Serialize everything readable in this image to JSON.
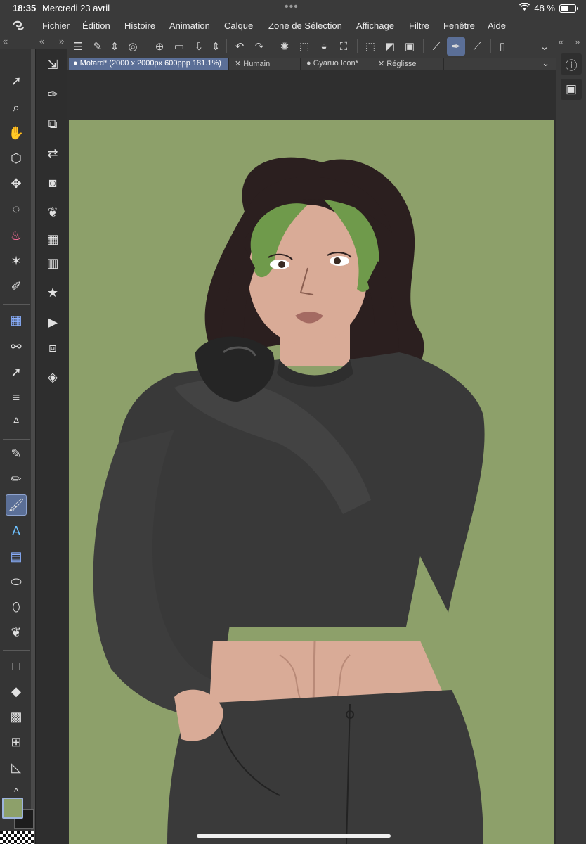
{
  "status": {
    "time": "18:35",
    "date": "Mercredi 23 avril",
    "battery": "48 %",
    "battery_level": 0.48
  },
  "menu": {
    "items": [
      "Fichier",
      "Édition",
      "Histoire",
      "Animation",
      "Calque",
      "Zone de Sélection",
      "Affichage",
      "Filtre",
      "Fenêtre",
      "Aide"
    ]
  },
  "tabs": [
    {
      "label": "Motard* (2000 x 2000px 600ppp 181.1%)",
      "active": true,
      "prefix": "●"
    },
    {
      "label": "Humain",
      "active": false,
      "prefix": "✕"
    },
    {
      "label": "Gyaruo Icon*",
      "active": false,
      "prefix": "●"
    },
    {
      "label": "Réglisse",
      "active": false,
      "prefix": "✕"
    }
  ],
  "colors": {
    "main": "#8da06a",
    "sub": "#1d1d1d",
    "accent": "#5b6f97",
    "canvas_bg": "#8da06a"
  },
  "icons": {
    "toolbar": [
      "menu-icon",
      "edit-icon",
      "sort-icon",
      "spiral-icon",
      "new-file-icon",
      "open-folder-icon",
      "save-icon",
      "arrows-icon",
      "undo-icon",
      "redo-icon",
      "select-icon",
      "select-all-icon",
      "fill-icon",
      "transform-icon",
      "clear-icon",
      "invert-icon",
      "marquee-icon",
      "ruler-icon",
      "pen-icon",
      "edit-line-icon",
      "device-icon",
      "chevron-down-icon"
    ],
    "tools": [
      "operation-icon",
      "zoom-icon",
      "hand-icon",
      "3d-icon",
      "move-icon",
      "lasso-icon",
      "cake-icon",
      "magic-wand-icon",
      "eyedropper-icon",
      "layer-icon",
      "chain-icon",
      "vector-icon",
      "lines-icon",
      "grass-icon",
      "pen-icon",
      "pencil-icon",
      "brush-icon",
      "text-icon",
      "image-icon",
      "blend-icon",
      "eraser-icon",
      "drops-icon",
      "rectangle-icon",
      "bucket-icon",
      "gradient-icon",
      "frame-icon",
      "ruler-icon"
    ]
  }
}
